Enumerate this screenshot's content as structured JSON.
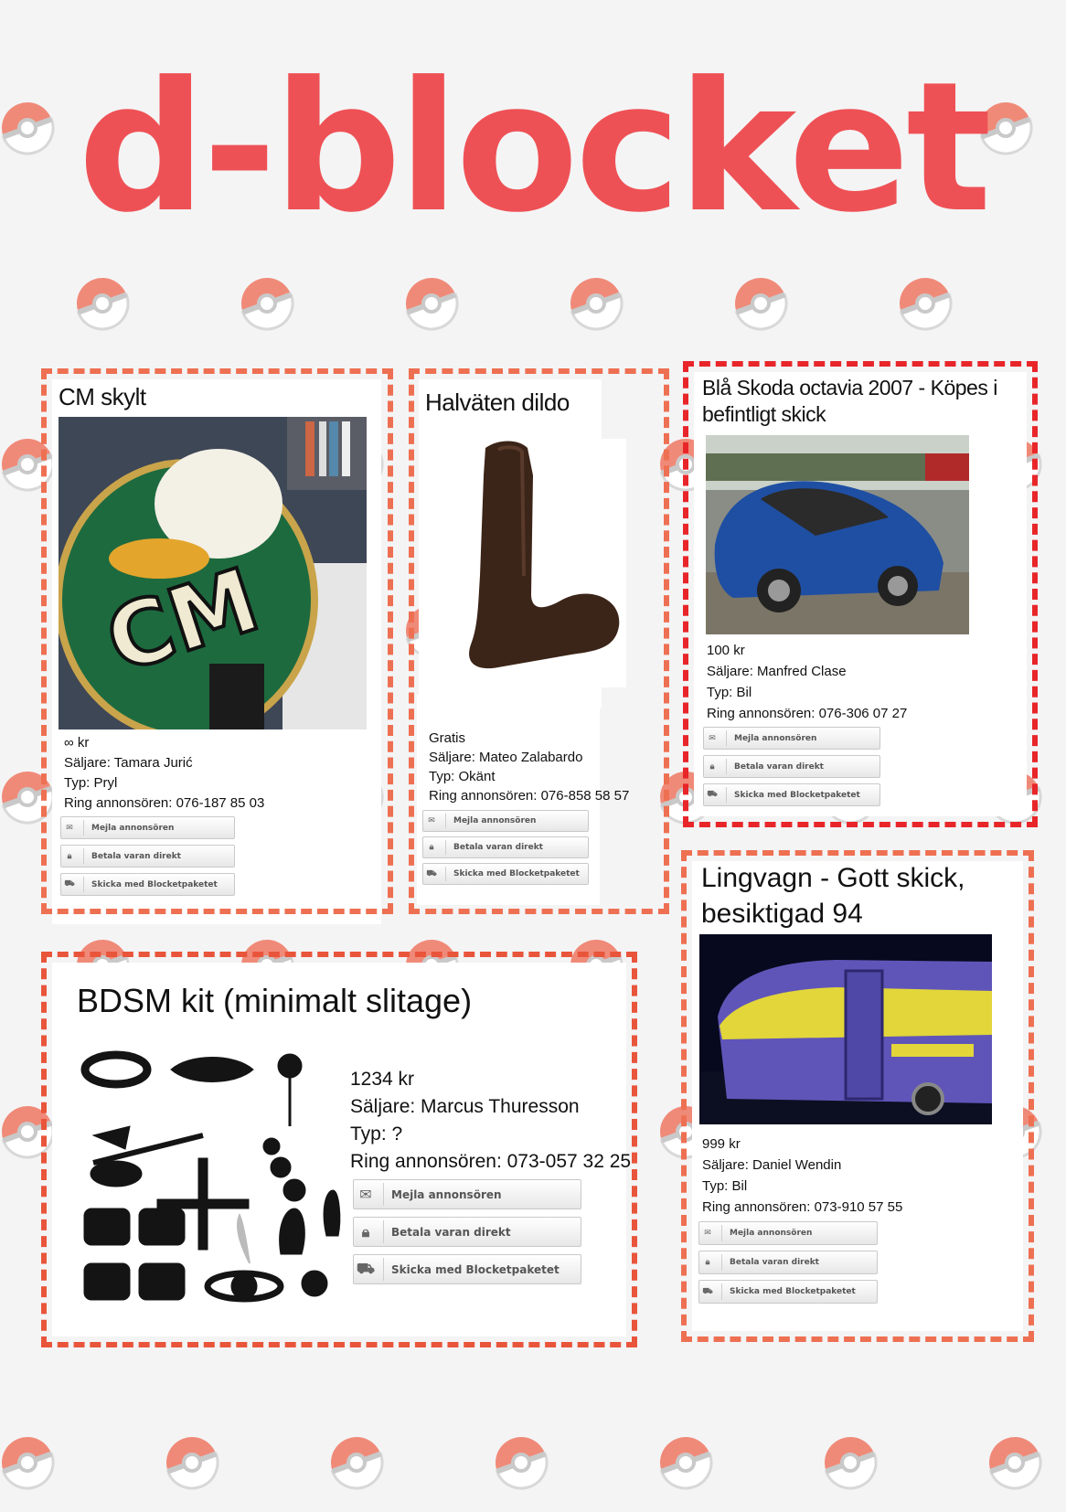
{
  "logo": "d-blocket",
  "colors": {
    "accent": "#ee5155",
    "border": "#ee7052",
    "border_red": "#e8262a"
  },
  "buttons": {
    "mail": "Mejla annonsören",
    "pay": "Betala varan direkt",
    "ship": "Skicka med Blocketpaketet",
    "mail_icon": "envelope-icon",
    "pay_icon": "lock-icon",
    "ship_icon": "truck-icon"
  },
  "listings": [
    {
      "title": "CM skylt",
      "price": "∞ kr",
      "seller": "Säljare: Tamara Jurić",
      "type": "Typ: Pryl",
      "phone": "Ring annonsören: 076-187 85 03"
    },
    {
      "title": "Halväten dildo",
      "price": "Gratis",
      "seller": "Säljare: Mateo Zalabardo",
      "type": "Typ: Okänt",
      "phone": "Ring annonsören: 076-858 58 57"
    },
    {
      "title": "Blå Skoda octavia 2007 - Köpes i befintligt skick",
      "price": "100 kr",
      "seller": "Säljare: Manfred Clase",
      "type": "Typ: Bil",
      "phone": "Ring annonsören: 076-306 07 27"
    },
    {
      "title": "BDSM kit (minimalt slitage)",
      "price": "1234 kr",
      "seller": "Säljare: Marcus Thuresson",
      "type": "Typ: ?",
      "phone": "Ring annonsören: 073-057 32 25"
    },
    {
      "title": "Lingvagn - Gott skick, besiktigad 94",
      "price": "999 kr",
      "seller": "Säljare: Daniel Wendin",
      "type": "Typ: Bil",
      "phone": "Ring annonsören:  073-910 57 55"
    }
  ]
}
